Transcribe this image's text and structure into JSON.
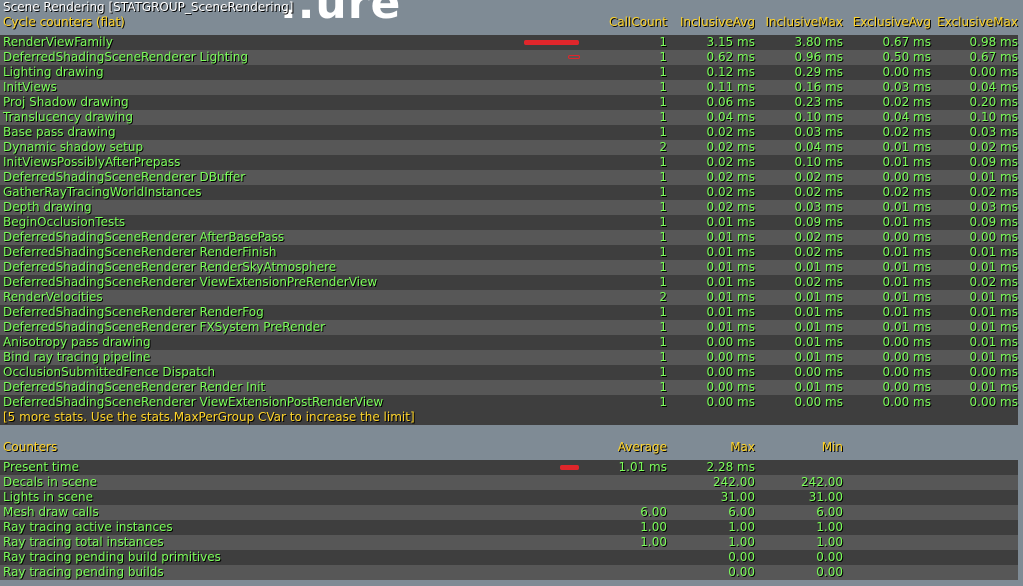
{
  "background_title": "..ure",
  "title": "Scene Rendering [STATGROUP_SceneRendering]",
  "cycle_header": {
    "name": "Cycle counters (flat)",
    "callcount": "CallCount",
    "inc_avg": "InclusiveAvg",
    "inc_max": "InclusiveMax",
    "exc_avg": "ExclusiveAvg",
    "exc_max": "ExclusiveMax"
  },
  "cycle_rows": [
    {
      "name": "RenderViewFamily",
      "count": "1",
      "inc_avg": "3.15 ms",
      "inc_max": "3.80 ms",
      "exc_avg": "0.67 ms",
      "exc_max": "0.98 ms",
      "bar": 1.0
    },
    {
      "name": "DeferredShadingSceneRenderer Lighting",
      "count": "1",
      "inc_avg": "0.62 ms",
      "inc_max": "0.96 ms",
      "exc_avg": "0.50 ms",
      "exc_max": "0.67 ms",
      "bar": 0.2
    },
    {
      "name": "Lighting drawing",
      "count": "1",
      "inc_avg": "0.12 ms",
      "inc_max": "0.29 ms",
      "exc_avg": "0.00 ms",
      "exc_max": "0.00 ms"
    },
    {
      "name": "InitViews",
      "count": "1",
      "inc_avg": "0.11 ms",
      "inc_max": "0.16 ms",
      "exc_avg": "0.03 ms",
      "exc_max": "0.04 ms"
    },
    {
      "name": "Proj Shadow drawing",
      "count": "1",
      "inc_avg": "0.06 ms",
      "inc_max": "0.23 ms",
      "exc_avg": "0.02 ms",
      "exc_max": "0.20 ms"
    },
    {
      "name": "Translucency drawing",
      "count": "1",
      "inc_avg": "0.04 ms",
      "inc_max": "0.10 ms",
      "exc_avg": "0.04 ms",
      "exc_max": "0.10 ms"
    },
    {
      "name": "Base pass drawing",
      "count": "1",
      "inc_avg": "0.02 ms",
      "inc_max": "0.03 ms",
      "exc_avg": "0.02 ms",
      "exc_max": "0.03 ms"
    },
    {
      "name": "Dynamic shadow setup",
      "count": "2",
      "inc_avg": "0.02 ms",
      "inc_max": "0.04 ms",
      "exc_avg": "0.01 ms",
      "exc_max": "0.02 ms"
    },
    {
      "name": "InitViewsPossiblyAfterPrepass",
      "count": "1",
      "inc_avg": "0.02 ms",
      "inc_max": "0.10 ms",
      "exc_avg": "0.01 ms",
      "exc_max": "0.09 ms"
    },
    {
      "name": "DeferredShadingSceneRenderer DBuffer",
      "count": "1",
      "inc_avg": "0.02 ms",
      "inc_max": "0.02 ms",
      "exc_avg": "0.00 ms",
      "exc_max": "0.01 ms"
    },
    {
      "name": "GatherRayTracingWorldInstances",
      "count": "1",
      "inc_avg": "0.02 ms",
      "inc_max": "0.02 ms",
      "exc_avg": "0.02 ms",
      "exc_max": "0.02 ms"
    },
    {
      "name": "Depth drawing",
      "count": "1",
      "inc_avg": "0.02 ms",
      "inc_max": "0.03 ms",
      "exc_avg": "0.01 ms",
      "exc_max": "0.03 ms"
    },
    {
      "name": "BeginOcclusionTests",
      "count": "1",
      "inc_avg": "0.01 ms",
      "inc_max": "0.09 ms",
      "exc_avg": "0.01 ms",
      "exc_max": "0.09 ms"
    },
    {
      "name": "DeferredShadingSceneRenderer AfterBasePass",
      "count": "1",
      "inc_avg": "0.01 ms",
      "inc_max": "0.02 ms",
      "exc_avg": "0.00 ms",
      "exc_max": "0.00 ms"
    },
    {
      "name": "DeferredShadingSceneRenderer RenderFinish",
      "count": "1",
      "inc_avg": "0.01 ms",
      "inc_max": "0.02 ms",
      "exc_avg": "0.01 ms",
      "exc_max": "0.01 ms"
    },
    {
      "name": "DeferredShadingSceneRenderer RenderSkyAtmosphere",
      "count": "1",
      "inc_avg": "0.01 ms",
      "inc_max": "0.01 ms",
      "exc_avg": "0.01 ms",
      "exc_max": "0.01 ms"
    },
    {
      "name": "DeferredShadingSceneRenderer ViewExtensionPreRenderView",
      "count": "1",
      "inc_avg": "0.01 ms",
      "inc_max": "0.02 ms",
      "exc_avg": "0.01 ms",
      "exc_max": "0.02 ms"
    },
    {
      "name": "RenderVelocities",
      "count": "2",
      "inc_avg": "0.01 ms",
      "inc_max": "0.01 ms",
      "exc_avg": "0.01 ms",
      "exc_max": "0.01 ms"
    },
    {
      "name": "DeferredShadingSceneRenderer RenderFog",
      "count": "1",
      "inc_avg": "0.01 ms",
      "inc_max": "0.01 ms",
      "exc_avg": "0.01 ms",
      "exc_max": "0.01 ms"
    },
    {
      "name": "DeferredShadingSceneRenderer FXSystem PreRender",
      "count": "1",
      "inc_avg": "0.01 ms",
      "inc_max": "0.01 ms",
      "exc_avg": "0.01 ms",
      "exc_max": "0.01 ms"
    },
    {
      "name": "Anisotropy pass drawing",
      "count": "1",
      "inc_avg": "0.00 ms",
      "inc_max": "0.01 ms",
      "exc_avg": "0.00 ms",
      "exc_max": "0.01 ms"
    },
    {
      "name": "Bind ray tracing pipeline",
      "count": "1",
      "inc_avg": "0.00 ms",
      "inc_max": "0.01 ms",
      "exc_avg": "0.00 ms",
      "exc_max": "0.01 ms"
    },
    {
      "name": "OcclusionSubmittedFence Dispatch",
      "count": "1",
      "inc_avg": "0.00 ms",
      "inc_max": "0.00 ms",
      "exc_avg": "0.00 ms",
      "exc_max": "0.00 ms"
    },
    {
      "name": "DeferredShadingSceneRenderer Render Init",
      "count": "1",
      "inc_avg": "0.00 ms",
      "inc_max": "0.01 ms",
      "exc_avg": "0.00 ms",
      "exc_max": "0.01 ms"
    },
    {
      "name": "DeferredShadingSceneRenderer ViewExtensionPostRenderView",
      "count": "1",
      "inc_avg": "0.00 ms",
      "inc_max": "0.00 ms",
      "exc_avg": "0.00 ms",
      "exc_max": "0.00 ms"
    }
  ],
  "more_stats_note": "[5 more stats. Use the stats.MaxPerGroup CVar to increase the limit]",
  "counters_header": {
    "name": "Counters",
    "average": "Average",
    "max": "Max",
    "min": "Min"
  },
  "counter_rows": [
    {
      "name": "Present time",
      "average": "1.01 ms",
      "max": "2.28 ms",
      "min": "",
      "bar": 1.0
    },
    {
      "name": "Decals in scene",
      "average": "",
      "max": "242.00",
      "min": "242.00"
    },
    {
      "name": "Lights in scene",
      "average": "",
      "max": "31.00",
      "min": "31.00"
    },
    {
      "name": "Mesh draw calls",
      "average": "6.00",
      "max": "6.00",
      "min": "6.00"
    },
    {
      "name": "Ray tracing active instances",
      "average": "1.00",
      "max": "1.00",
      "min": "1.00"
    },
    {
      "name": "Ray tracing total instances",
      "average": "1.00",
      "max": "1.00",
      "min": "1.00"
    },
    {
      "name": "Ray tracing pending build primitives",
      "average": "",
      "max": "0.00",
      "min": "0.00"
    },
    {
      "name": "Ray tracing pending builds",
      "average": "",
      "max": "0.00",
      "min": "0.00"
    }
  ],
  "colors": {
    "text": "#7cff5a",
    "header": "#ffd52a",
    "bar": "#e0262b",
    "row_dark": "#3e3e3e",
    "row_light": "#575757"
  }
}
